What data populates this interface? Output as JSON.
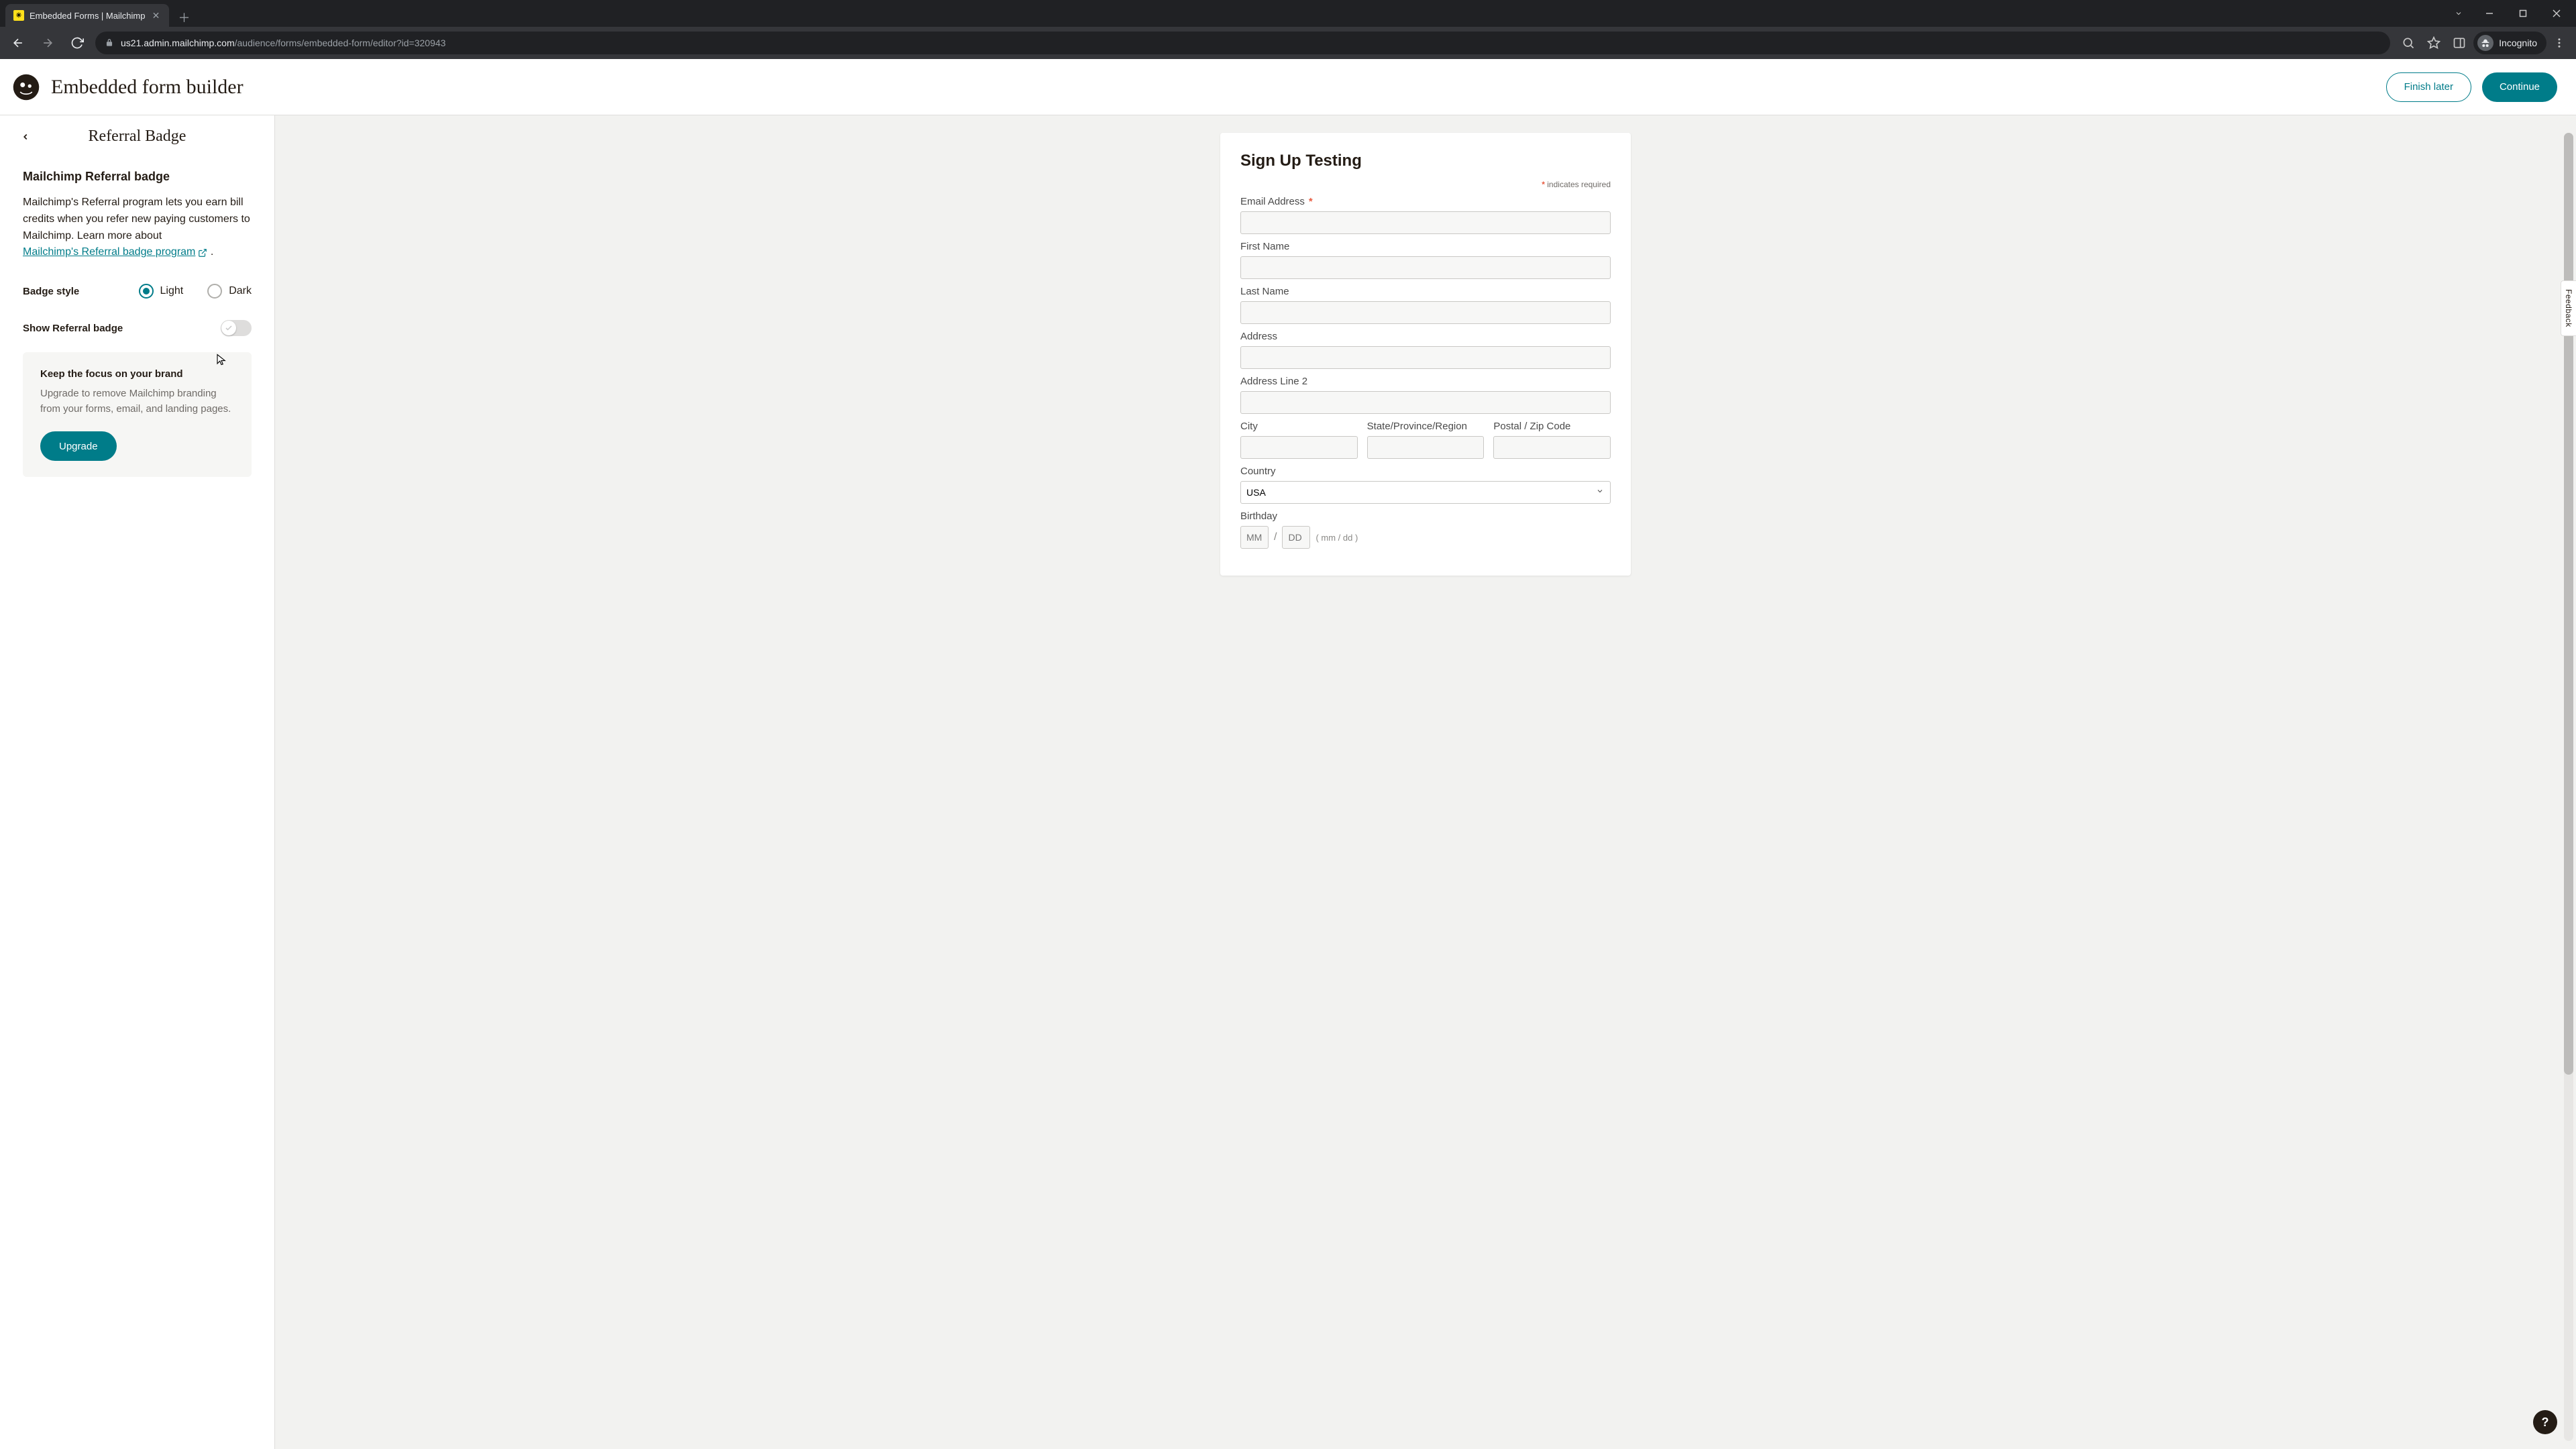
{
  "browser": {
    "tab_title": "Embedded Forms | Mailchimp",
    "url_host": "us21.admin.mailchimp.com",
    "url_path": "/audience/forms/embedded-form/editor?id=320943",
    "incognito_label": "Incognito"
  },
  "header": {
    "app_title": "Embedded form builder",
    "finish_later": "Finish later",
    "continue": "Continue"
  },
  "panel": {
    "title": "Referral Badge",
    "section_heading": "Mailchimp Referral badge",
    "description": "Mailchimp's Referral program lets you earn bill credits when you refer new paying customers to Mailchimp. Learn more about ",
    "link_text": "Mailchimp's Referral badge program",
    "description_trail": " .",
    "badge_style_label": "Badge style",
    "option_light": "Light",
    "option_dark": "Dark",
    "show_badge_label": "Show Referral badge",
    "upsell_title": "Keep the focus on your brand",
    "upsell_body": "Upgrade to remove Mailchimp branding from your forms, email, and landing pages.",
    "upgrade_button": "Upgrade"
  },
  "preview": {
    "form_title": "Sign Up Testing",
    "required_note": "indicates required",
    "fields": {
      "email": "Email Address",
      "first_name": "First Name",
      "last_name": "Last Name",
      "address": "Address",
      "address2": "Address Line 2",
      "city": "City",
      "state": "State/Province/Region",
      "postal": "Postal / Zip Code",
      "country": "Country",
      "country_value": "USA",
      "birthday": "Birthday",
      "bday_mm": "MM",
      "bday_dd": "DD",
      "bday_hint": "( mm / dd )"
    }
  },
  "feedback_label": "Feedback",
  "help_label": "?"
}
